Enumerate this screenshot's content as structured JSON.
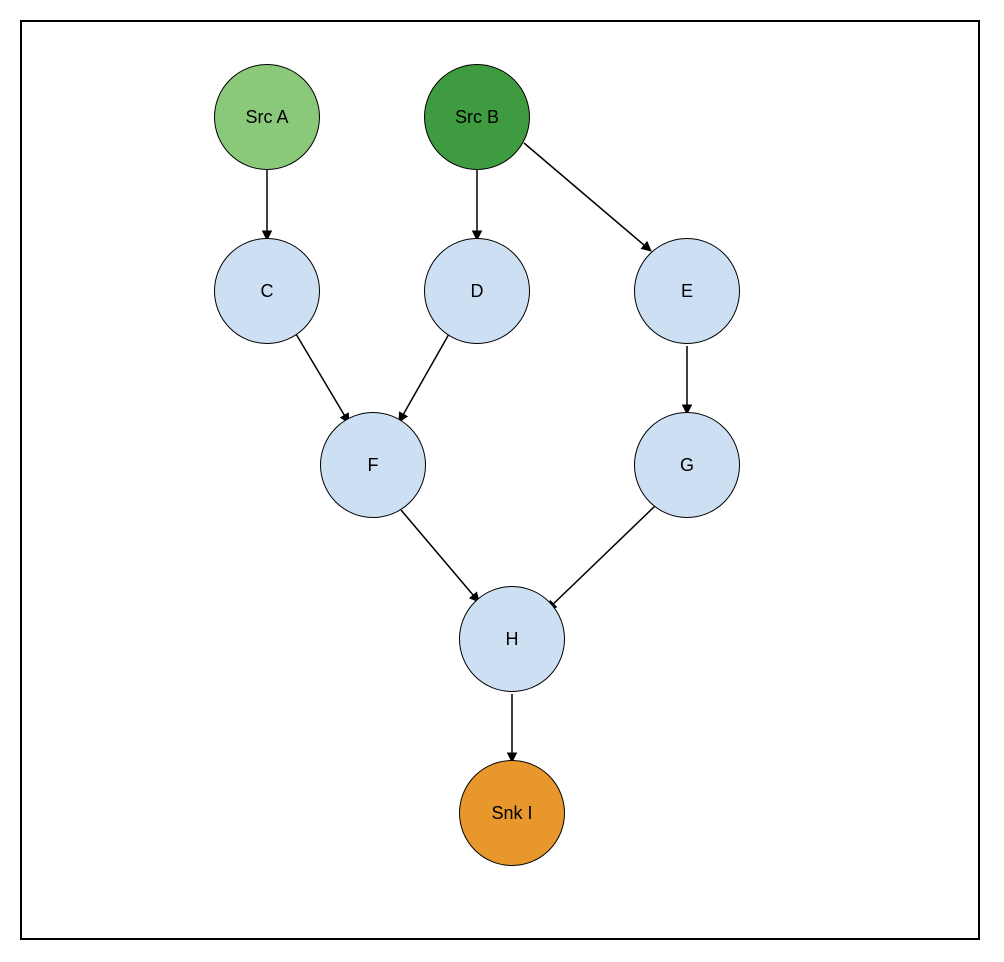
{
  "diagram": {
    "nodes": {
      "a": {
        "label": "Src A",
        "type": "source",
        "fill": "#8bc97a"
      },
      "b": {
        "label": "Src B",
        "type": "source",
        "fill": "#3f9b3f"
      },
      "c": {
        "label": "C",
        "type": "intermediate",
        "fill": "#cde0f3"
      },
      "d": {
        "label": "D",
        "type": "intermediate",
        "fill": "#cde0f3"
      },
      "e": {
        "label": "E",
        "type": "intermediate",
        "fill": "#cde0f3"
      },
      "f": {
        "label": "F",
        "type": "intermediate",
        "fill": "#cde0f3"
      },
      "g": {
        "label": "G",
        "type": "intermediate",
        "fill": "#cde0f3"
      },
      "h": {
        "label": "H",
        "type": "intermediate",
        "fill": "#cde0f3"
      },
      "i": {
        "label": "Snk I",
        "type": "sink",
        "fill": "#e8972d"
      }
    },
    "edges": [
      {
        "from": "a",
        "to": "c"
      },
      {
        "from": "b",
        "to": "d"
      },
      {
        "from": "b",
        "to": "e"
      },
      {
        "from": "c",
        "to": "f"
      },
      {
        "from": "d",
        "to": "f"
      },
      {
        "from": "e",
        "to": "g"
      },
      {
        "from": "f",
        "to": "h"
      },
      {
        "from": "g",
        "to": "h"
      },
      {
        "from": "h",
        "to": "i"
      }
    ]
  }
}
